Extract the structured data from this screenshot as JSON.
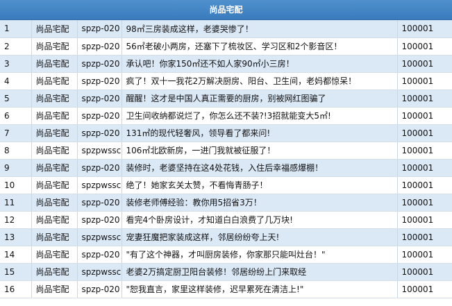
{
  "header": {
    "title": "尚品宅配"
  },
  "rows": [
    {
      "no": "1",
      "source": "尚品宅配",
      "code": "spzp-020",
      "title": "98㎡三房装成这样，老婆哭惨了！",
      "value": "100001"
    },
    {
      "no": "2",
      "source": "尚品宅配",
      "code": "spzp-020",
      "title": "56㎡老破小两房，还塞下了梳妆区、学习区和2个影音区！",
      "value": "100001"
    },
    {
      "no": "3",
      "source": "尚品宅配",
      "code": "spzp-020",
      "title": "承认吧！你家150㎡还不如人家90㎡小三房！",
      "value": "100001"
    },
    {
      "no": "4",
      "source": "尚品宅配",
      "code": "spzp-020",
      "title": "疯了！双十一我花2万解决厨房、阳台、卫生间，老妈都惊呆！",
      "value": "100001"
    },
    {
      "no": "5",
      "source": "尚品宅配",
      "code": "spzp-020",
      "title": "醒醒！这才是中国人真正需要的厨房，别被网红图骗了",
      "value": "100001"
    },
    {
      "no": "6",
      "source": "尚品宅配",
      "code": "spzp-020",
      "title": "卫生间收纳都说烂了，你怎么还不装?!3招就能变大5㎡!",
      "value": "100001"
    },
    {
      "no": "7",
      "source": "尚品宅配",
      "code": "spzp-020",
      "title": "131㎡的现代轻奢风，领导看了都来问!",
      "value": "100001"
    },
    {
      "no": "8",
      "source": "尚品宅配",
      "code": "spzpwssc",
      "title": "106㎡北欧新房，一进门我就被征服了！",
      "value": "100001"
    },
    {
      "no": "9",
      "source": "尚品宅配",
      "code": "spzp-020",
      "title": "装修时，老婆坚持在这4处花钱，入住后幸福感爆棚！",
      "value": "100001"
    },
    {
      "no": "10",
      "source": "尚品宅配",
      "code": "spzpwssc",
      "title": "绝了！她家玄关太赞，不看悔青肠子！",
      "value": "100001"
    },
    {
      "no": "11",
      "source": "尚品宅配",
      "code": "spzp-020",
      "title": "装修老师傅经验：教你用5招省3万！",
      "value": "100001"
    },
    {
      "no": "12",
      "source": "尚品宅配",
      "code": "spzp-020",
      "title": "看完4个卧房设计，才知道白白浪费了几万块!",
      "value": "100001"
    },
    {
      "no": "13",
      "source": "尚品宅配",
      "code": "spzpwssc",
      "title": "宠妻狂魔把家装成这样，邻居纷纷夸上天!",
      "value": "100001"
    },
    {
      "no": "14",
      "source": "尚品宅配",
      "code": "spzp-020",
      "title": "\"有了这个神器，才叫厨房装修，你家那只能叫灶台！\"",
      "value": "100001"
    },
    {
      "no": "15",
      "source": "尚品宅配",
      "code": "spzpwssc",
      "title": "老婆2万搞定厨卫阳台装修！邻居纷纷上门来取经",
      "value": "100001"
    },
    {
      "no": "16",
      "source": "尚品宅配",
      "code": "spzp-020",
      "title": "\"恕我直言，家里这样装修，迟早累死在清洁上!\"",
      "value": "100001"
    }
  ]
}
